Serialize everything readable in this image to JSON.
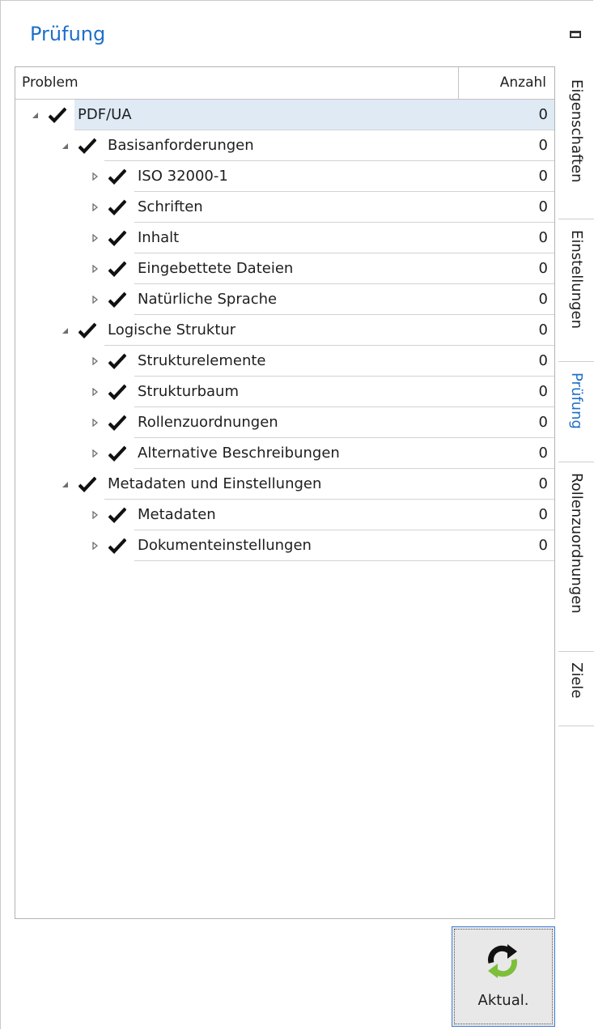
{
  "panel": {
    "title": "Prüfung"
  },
  "tree": {
    "columns": {
      "problem": "Problem",
      "count": "Anzahl"
    },
    "rows": [
      {
        "label": "PDF/UA",
        "count": "0",
        "level": 0,
        "expanded": true,
        "selected": true
      },
      {
        "label": "Basisanforderungen",
        "count": "0",
        "level": 1,
        "expanded": true
      },
      {
        "label": "ISO 32000-1",
        "count": "0",
        "level": 2,
        "expanded": false
      },
      {
        "label": "Schriften",
        "count": "0",
        "level": 2,
        "expanded": false
      },
      {
        "label": "Inhalt",
        "count": "0",
        "level": 2,
        "expanded": false
      },
      {
        "label": "Eingebettete Dateien",
        "count": "0",
        "level": 2,
        "expanded": false
      },
      {
        "label": "Natürliche Sprache",
        "count": "0",
        "level": 2,
        "expanded": false
      },
      {
        "label": "Logische Struktur",
        "count": "0",
        "level": 1,
        "expanded": true
      },
      {
        "label": "Strukturelemente",
        "count": "0",
        "level": 2,
        "expanded": false
      },
      {
        "label": "Strukturbaum",
        "count": "0",
        "level": 2,
        "expanded": false
      },
      {
        "label": "Rollenzuordnungen",
        "count": "0",
        "level": 2,
        "expanded": false
      },
      {
        "label": "Alternative Beschreibungen",
        "count": "0",
        "level": 2,
        "expanded": false
      },
      {
        "label": "Metadaten und Einstellungen",
        "count": "0",
        "level": 1,
        "expanded": true
      },
      {
        "label": "Metadaten",
        "count": "0",
        "level": 2,
        "expanded": false
      },
      {
        "label": "Dokumenteinstellungen",
        "count": "0",
        "level": 2,
        "expanded": false
      }
    ]
  },
  "side_tabs": [
    {
      "label": "Eigenschaften",
      "active": false
    },
    {
      "label": "Einstellungen",
      "active": false
    },
    {
      "label": "Prüfung",
      "active": true
    },
    {
      "label": "Rollenzuordnungen",
      "active": false
    },
    {
      "label": "Ziele",
      "active": false
    }
  ],
  "refresh_button": {
    "label": "Aktual.",
    "icon": "refresh-icon"
  },
  "colors": {
    "accent": "#1f6fc9",
    "selected_row": "#dfeaf5",
    "refresh_green": "#7dbf3a"
  }
}
